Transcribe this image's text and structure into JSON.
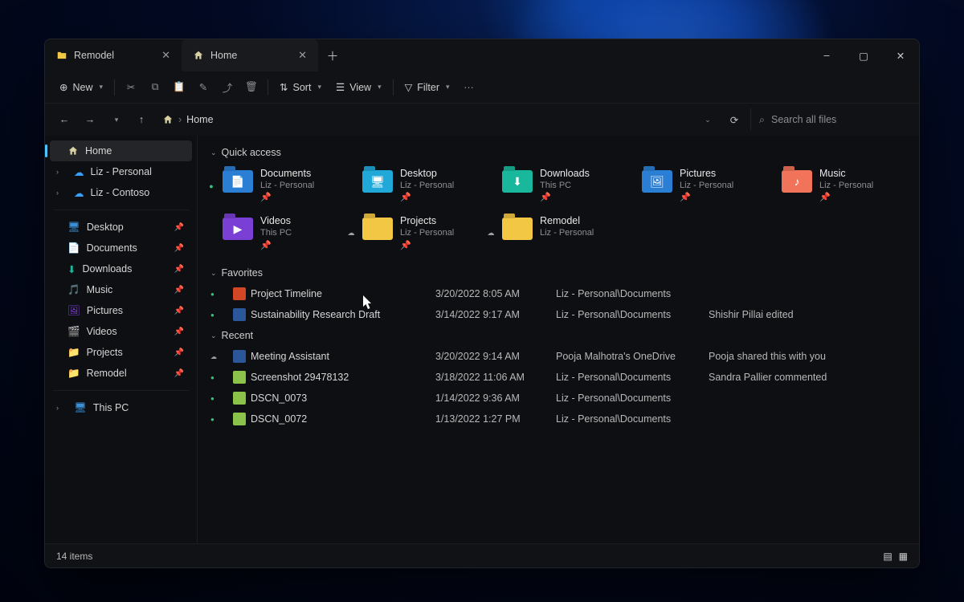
{
  "tabs": [
    {
      "label": "Remodel",
      "active": false,
      "icon": "folder"
    },
    {
      "label": "Home",
      "active": true,
      "icon": "home"
    }
  ],
  "window_controls": {
    "min": "–",
    "max": "▢",
    "close": "✕"
  },
  "toolbar": {
    "new": "New",
    "sort": "Sort",
    "view": "View",
    "filter": "Filter"
  },
  "breadcrumb": {
    "root_icon": "home",
    "sep": "›",
    "current": "Home"
  },
  "search": {
    "placeholder": "Search all files"
  },
  "sidebar": {
    "top": [
      {
        "label": "Home",
        "icon": "home",
        "active": true
      },
      {
        "label": "Liz - Personal",
        "icon": "cloud-blue",
        "expandable": true
      },
      {
        "label": "Liz - Contoso",
        "icon": "cloud-blue",
        "expandable": true
      }
    ],
    "pinned": [
      {
        "label": "Desktop",
        "icon": "desktop"
      },
      {
        "label": "Documents",
        "icon": "documents"
      },
      {
        "label": "Downloads",
        "icon": "downloads"
      },
      {
        "label": "Music",
        "icon": "music"
      },
      {
        "label": "Pictures",
        "icon": "pictures"
      },
      {
        "label": "Videos",
        "icon": "videos"
      },
      {
        "label": "Projects",
        "icon": "folder"
      },
      {
        "label": "Remodel",
        "icon": "folder"
      }
    ],
    "thispc": {
      "label": "This PC",
      "icon": "thispc"
    }
  },
  "sections": {
    "quick_access": "Quick access",
    "favorites": "Favorites",
    "recent": "Recent"
  },
  "quick_access": [
    {
      "name": "Documents",
      "sub": "Liz - Personal",
      "color": "#2a7fd4",
      "status": "synced",
      "pinned": true
    },
    {
      "name": "Desktop",
      "sub": "Liz - Personal",
      "color": "#1fa8d8",
      "status": "",
      "pinned": true
    },
    {
      "name": "Downloads",
      "sub": "This PC",
      "color": "#19b89c",
      "status": "",
      "pinned": true
    },
    {
      "name": "Pictures",
      "sub": "Liz - Personal",
      "color": "#2a7fd4",
      "status": "",
      "pinned": true
    },
    {
      "name": "Music",
      "sub": "Liz - Personal",
      "color": "#f0735a",
      "status": "",
      "pinned": true
    },
    {
      "name": "Videos",
      "sub": "This PC",
      "color": "#7a3fd4",
      "status": "",
      "pinned": true
    },
    {
      "name": "Projects",
      "sub": "Liz - Personal",
      "color": "#f2c744",
      "status": "cloud",
      "pinned": true
    },
    {
      "name": "Remodel",
      "sub": "Liz - Personal",
      "color": "#f2c744",
      "status": "cloud",
      "pinned": false
    }
  ],
  "favorites": [
    {
      "name": "Project Timeline",
      "date": "3/20/2022 8:05 AM",
      "loc": "Liz - Personal\\Documents",
      "note": "",
      "type": "ppt",
      "status": "synced"
    },
    {
      "name": "Sustainability Research Draft",
      "date": "3/14/2022 9:17 AM",
      "loc": "Liz - Personal\\Documents",
      "note": "Shishir Pillai edited",
      "type": "word",
      "status": "synced"
    }
  ],
  "recent": [
    {
      "name": "Meeting Assistant",
      "date": "3/20/2022 9:14 AM",
      "loc": "Pooja Malhotra's OneDrive",
      "note": "Pooja shared this with you",
      "type": "word",
      "status": "cloud"
    },
    {
      "name": "Screenshot 29478132",
      "date": "3/18/2022 11:06 AM",
      "loc": "Liz - Personal\\Documents",
      "note": "Sandra Pallier commented",
      "type": "image",
      "status": "synced"
    },
    {
      "name": "DSCN_0073",
      "date": "1/14/2022 9:36 AM",
      "loc": "Liz - Personal\\Documents",
      "note": "",
      "type": "image",
      "status": "synced"
    },
    {
      "name": "DSCN_0072",
      "date": "1/13/2022 1:27 PM",
      "loc": "Liz - Personal\\Documents",
      "note": "",
      "type": "image",
      "status": "synced"
    }
  ],
  "statusbar": {
    "items": "14 items"
  }
}
